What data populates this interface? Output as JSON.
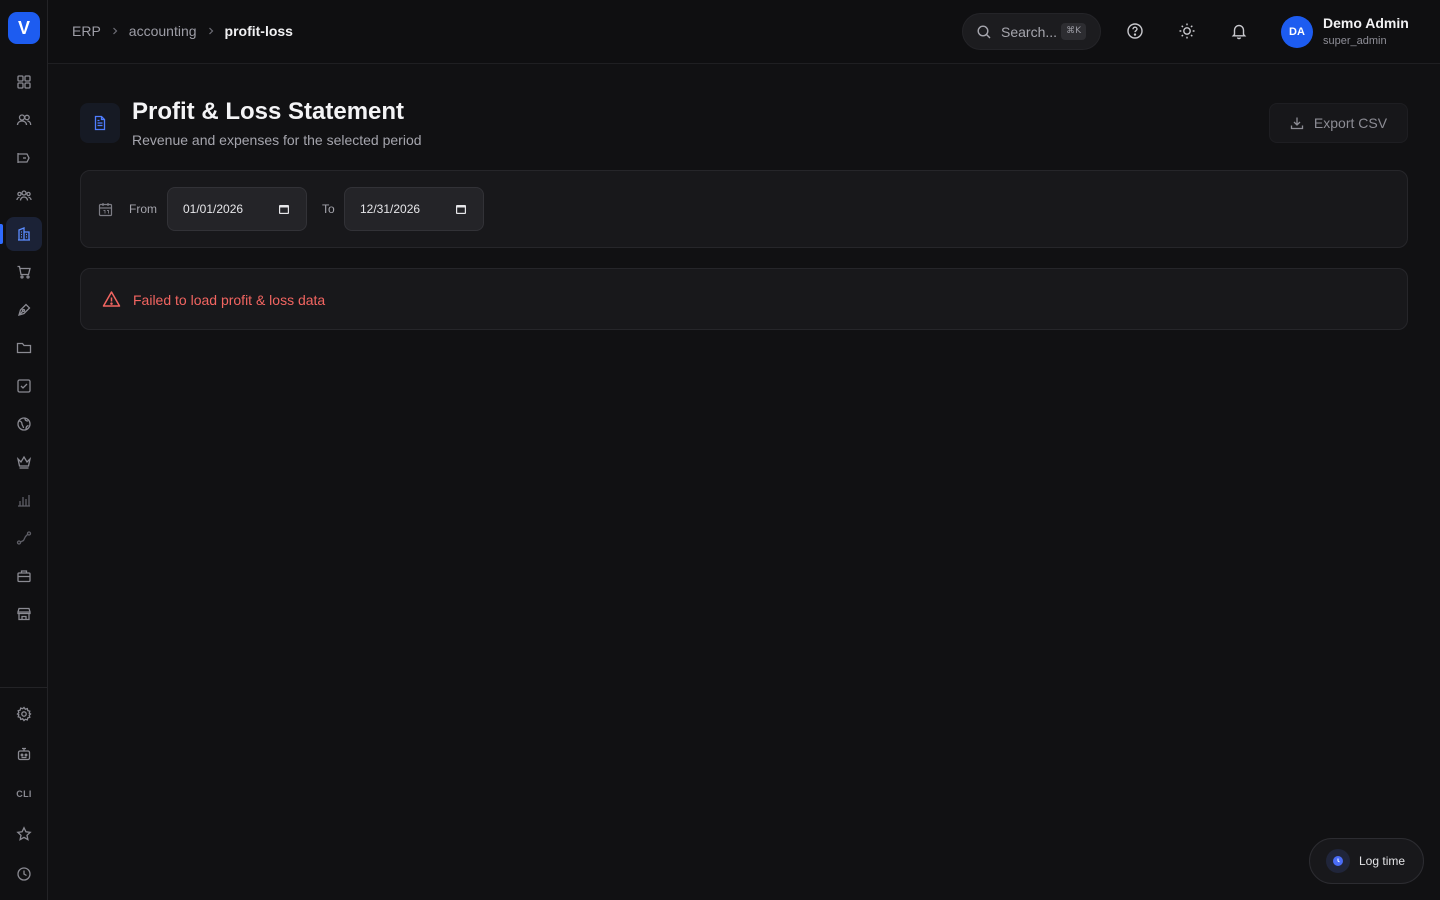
{
  "sidebar": {
    "logo_letter": "V",
    "items": [
      {
        "icon": "dashboard-grid-icon"
      },
      {
        "icon": "users-icon"
      },
      {
        "icon": "megaphone-icon"
      },
      {
        "icon": "team-icon"
      },
      {
        "icon": "accounting-building-icon",
        "active": true
      },
      {
        "icon": "shopping-cart-icon"
      },
      {
        "icon": "pen-tool-icon"
      },
      {
        "icon": "folder-icon"
      },
      {
        "icon": "checkbox-icon"
      },
      {
        "icon": "globe-icon"
      },
      {
        "icon": "crown-icon"
      },
      {
        "icon": "bar-chart-icon"
      },
      {
        "icon": "route-icon"
      },
      {
        "icon": "briefcase-icon"
      },
      {
        "icon": "store-icon"
      }
    ],
    "bottom_items": [
      {
        "icon": "settings-gear-icon"
      },
      {
        "icon": "bot-icon"
      },
      {
        "label": "CLI"
      },
      {
        "icon": "star-icon"
      },
      {
        "icon": "clock-icon"
      }
    ],
    "cli_label": "CLI"
  },
  "breadcrumb": {
    "items": [
      "ERP",
      "accounting",
      "profit-loss"
    ]
  },
  "header": {
    "search_placeholder": "Search...",
    "search_shortcut": "⌘K",
    "user": {
      "initials": "DA",
      "name": "Demo Admin",
      "role": "super_admin"
    }
  },
  "page": {
    "title": "Profit & Loss Statement",
    "subtitle": "Revenue and expenses for the selected period",
    "export_label": "Export CSV"
  },
  "filters": {
    "from_label": "From",
    "from_value": "01/01/2026",
    "to_label": "To",
    "to_value": "12/31/2026"
  },
  "error": {
    "message": "Failed to load profit & loss data"
  },
  "log_time": {
    "label": "Log time"
  },
  "colors": {
    "accent": "#1d5cf0",
    "error": "#f26561",
    "background": "#111113"
  }
}
